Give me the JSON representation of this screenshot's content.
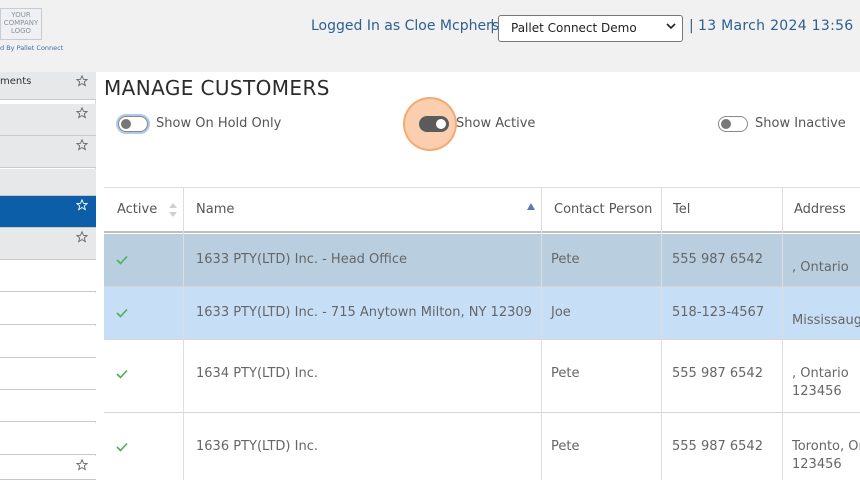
{
  "header": {
    "logo_lines": [
      "YOUR",
      "COMPANY",
      "LOGO"
    ],
    "powered_by": "d By Pallet Connect",
    "logged_in": "Logged In as Cloe Mcpherson",
    "separator": "|",
    "company_selected": "Pallet Connect Demo",
    "datetime": "13 March 2024 13:56"
  },
  "sidebar": {
    "items": [
      {
        "label": "ments",
        "state": "grey",
        "starred": true
      },
      {
        "label": "",
        "state": "grey",
        "starred": true
      },
      {
        "label": "",
        "state": "grey",
        "starred": true
      },
      {
        "label": "",
        "state": "grey",
        "starred": false
      },
      {
        "label": "",
        "state": "active",
        "starred": true
      },
      {
        "label": "",
        "state": "grey",
        "starred": true
      },
      {
        "label": "",
        "state": "plain",
        "starred": false
      },
      {
        "label": "",
        "state": "plain",
        "starred": false
      },
      {
        "label": "",
        "state": "plain",
        "starred": false
      },
      {
        "label": "",
        "state": "plain",
        "starred": false
      },
      {
        "label": "",
        "state": "plain",
        "starred": false
      },
      {
        "label": "",
        "state": "plain",
        "starred": false
      },
      {
        "label": "",
        "state": "plain",
        "starred": true
      }
    ]
  },
  "page": {
    "title": "MANAGE CUSTOMERS",
    "toggles": [
      {
        "label": "Show On Hold Only",
        "on": false
      },
      {
        "label": "Show Active",
        "on": true
      },
      {
        "label": "Show Inactive",
        "on": false
      }
    ]
  },
  "table": {
    "columns": [
      "Active",
      "Name",
      "Contact Person",
      "Tel",
      "Address"
    ],
    "rows": [
      {
        "active": true,
        "name": "1633 PTY(LTD) Inc. - Head Office",
        "contact": "Pete",
        "tel": "555 987 6542",
        "address": [
          ", Ontario"
        ],
        "bg": "#b9cfdf"
      },
      {
        "active": true,
        "name": "1633 PTY(LTD) Inc. - 715 Anytown Milton, NY 12309",
        "contact": "Joe",
        "tel": "518-123-4567",
        "address": [
          "Mississauga"
        ],
        "bg": "#c7dff6"
      },
      {
        "active": true,
        "name": "1634 PTY(LTD) Inc.",
        "contact": "Pete",
        "tel": "555 987 6542",
        "address": [
          ", Ontario",
          "123456"
        ],
        "bg": "#ffffff"
      },
      {
        "active": true,
        "name": "1636 PTY(LTD) Inc.",
        "contact": "Pete",
        "tel": "555 987 6542",
        "address": [
          "Toronto, On",
          "123456"
        ],
        "bg": "#ffffff"
      }
    ]
  },
  "colors": {
    "accent": "#2d5f91",
    "sidebar_active": "#0d5ea8",
    "check": "#4caf50"
  }
}
